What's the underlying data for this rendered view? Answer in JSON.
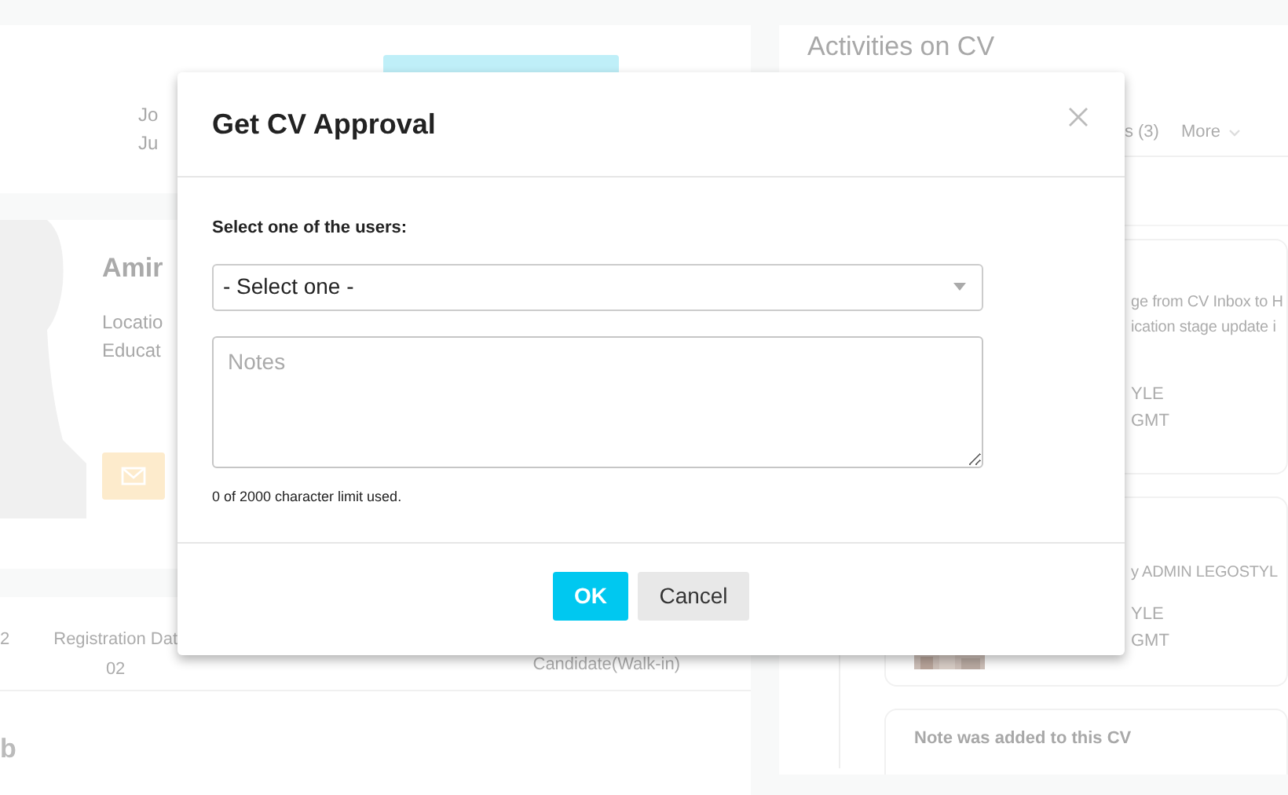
{
  "background": {
    "profile_header": {
      "lines": [
        "Jo",
        "Ju"
      ]
    },
    "profile": {
      "name": "Amir",
      "details": [
        "Locatio",
        "Educat"
      ]
    },
    "summary": {
      "column_1": "2",
      "column_2": {
        "label": "Registration Dat",
        "value": "02"
      },
      "column_3": "Candidate(Walk-in)"
    },
    "section_heading": "b",
    "activities": {
      "title": "Activities on CV",
      "tabs": [
        "s (3)",
        "More"
      ],
      "entries": [
        {
          "lines": [
            "ge from CV Inbox to H",
            "ication stage update i"
          ],
          "meta": [
            "YLE",
            "GMT"
          ]
        },
        {
          "lines": [
            "y ADMIN LEGOSTYL"
          ],
          "meta": [
            "YLE",
            "GMT"
          ],
          "attachment": {
            "kind": "picture"
          }
        },
        {
          "title": "Note was added to this CV"
        }
      ]
    }
  },
  "dialog": {
    "title": "Get CV Approval",
    "label": "Select one of the users:",
    "select": {
      "value": "- Select one -"
    },
    "notes": {
      "placeholder": "Notes"
    },
    "hint": "0 of 2000 character limit used.",
    "buttons": [
      {
        "label": "OK",
        "kind": "primary"
      },
      {
        "label": "Cancel",
        "kind": "secondary"
      }
    ]
  }
}
